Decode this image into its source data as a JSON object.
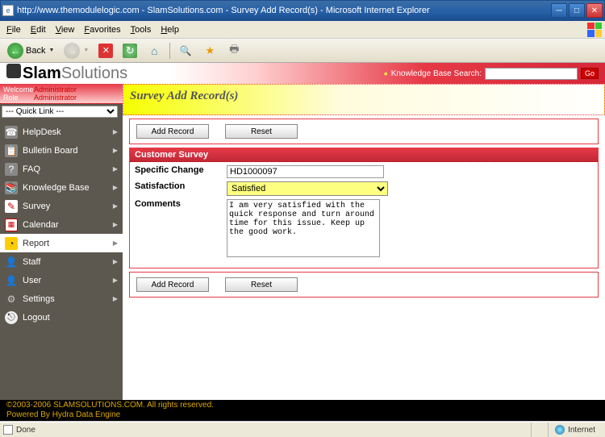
{
  "window": {
    "title": "http://www.themodulelogic.com - SlamSolutions.com - Survey Add Record(s) - Microsoft Internet Explorer"
  },
  "menubar": {
    "items": [
      "File",
      "Edit",
      "View",
      "Favorites",
      "Tools",
      "Help"
    ]
  },
  "toolbar": {
    "back": "Back"
  },
  "header": {
    "logo_slam": "Slam",
    "logo_solutions": "Solutions",
    "kb_label": "Knowledge Base Search:",
    "go": "Go"
  },
  "welcome": {
    "welcome_lbl": "Welcome",
    "welcome_val": "Administrator",
    "role_lbl": "Role",
    "role_val": "Administrator"
  },
  "quicklink": {
    "selected": "--- Quick Link ---"
  },
  "nav": {
    "helpdesk": "HelpDesk",
    "bulletin": "Bulletin Board",
    "faq": "FAQ",
    "kb": "Knowledge Base",
    "survey": "Survey",
    "calendar": "Calendar",
    "report": "Report",
    "staff": "Staff",
    "user": "User",
    "settings": "Settings",
    "logout": "Logout"
  },
  "page": {
    "title": "Survey Add Record(s)",
    "add_record": "Add Record",
    "reset": "Reset",
    "survey_head": "Customer Survey",
    "specific_change_lbl": "Specific Change",
    "specific_change_val": "HD1000097",
    "satisfaction_lbl": "Satisfaction",
    "satisfaction_val": "Satisfied",
    "comments_lbl": "Comments",
    "comments_val": "I am very satisfied with the quick response and turn around time for this issue. Keep up the good work."
  },
  "footer": {
    "line1": "©2003-2006 SLAMSOLUTIONS.COM. All rights reserved.",
    "line2": "Powered By Hydra Data Engine"
  },
  "statusbar": {
    "done": "Done",
    "zone": "Internet"
  }
}
